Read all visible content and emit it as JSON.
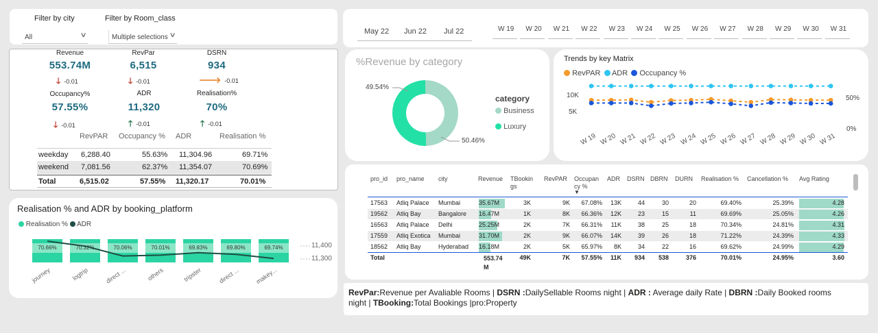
{
  "filters": {
    "city_label": "Filter by city",
    "city_value": "All",
    "room_label": "Filter by Room_class",
    "room_value": "Multiple selections"
  },
  "kpis": [
    {
      "label": "Revenue",
      "value": "553.74M",
      "delta": "-0.01",
      "trend": "down"
    },
    {
      "label": "RevPar",
      "value": "6,515",
      "delta": "-0.01",
      "trend": "down"
    },
    {
      "label": "DSRN",
      "value": "934",
      "delta": "-0.01",
      "trend": "right"
    },
    {
      "label": "Occupancy%",
      "value": "57.55%",
      "delta": "-0.01",
      "trend": "down"
    },
    {
      "label": "ADR",
      "value": "11,320",
      "delta": "-0.01",
      "trend": "up"
    },
    {
      "label": "Realisation%",
      "value": "70%",
      "delta": "-0.01",
      "trend": "up"
    }
  ],
  "day_table": {
    "headers": [
      "RevPAR",
      "Occupancy %",
      "ADR",
      "Realisation %"
    ],
    "rows": [
      {
        "name": "weekday",
        "revpar": "6,288.40",
        "occ": "55.63%",
        "adr": "11,304.96",
        "real": "69.71%"
      },
      {
        "name": "weekend",
        "revpar": "7,081.56",
        "occ": "62.37%",
        "adr": "11,354.07",
        "real": "70.69%"
      }
    ],
    "total": {
      "name": "Total",
      "revpar": "6,515.02",
      "occ": "57.55%",
      "adr": "11,320.17",
      "real": "70.01%"
    }
  },
  "platform_chart": {
    "title": "Realisation % and ADR by booking_platform",
    "legend": [
      "Realisation %",
      "ADR"
    ],
    "y_ticks": [
      "11,400",
      "11,300"
    ]
  },
  "dates": {
    "months": [
      "May 22",
      "Jun 22",
      "Jul 22"
    ],
    "weeks": [
      "W 19",
      "W 20",
      "W 21",
      "W 22",
      "W 23",
      "W 24",
      "W 25",
      "W 26",
      "W 27",
      "W 28",
      "W 29",
      "W 30",
      "W 31"
    ]
  },
  "donut": {
    "title": "%Revenue by category",
    "legend_title": "category",
    "labels": [
      "Business",
      "Luxury"
    ],
    "pct_labels": [
      "49.54%",
      "50.46%"
    ]
  },
  "trends": {
    "title": "Trends by key Matrix",
    "legend": [
      "RevPAR",
      "ADR",
      "Occupancy %"
    ],
    "y_left": [
      "10K",
      "5K"
    ],
    "y_right": [
      "50%",
      "0%"
    ]
  },
  "property_table": {
    "headers": [
      "pro_id",
      "pro_name",
      "city",
      "Revenue",
      "TBookin gs",
      "RevPAR",
      "Occupan cy %",
      "ADR",
      "DSRN",
      "DBRN",
      "DURN",
      "Realisation %",
      "Cancellation %",
      "Avg Rating"
    ],
    "rows": [
      [
        "17563",
        "Atliq Palace",
        "Mumbai",
        "35.67M",
        "3K",
        "9K",
        "67.08%",
        "13K",
        "44",
        "30",
        "20",
        "69.40%",
        "25.39%",
        "4.28"
      ],
      [
        "19562",
        "Atliq Bay",
        "Bangalore",
        "16.47M",
        "1K",
        "8K",
        "66.36%",
        "12K",
        "23",
        "15",
        "11",
        "69.69%",
        "25.05%",
        "4.26"
      ],
      [
        "16563",
        "Atliq Palace",
        "Delhi",
        "25.25M",
        "2K",
        "7K",
        "66.31%",
        "11K",
        "38",
        "25",
        "18",
        "70.34%",
        "24.81%",
        "4.31"
      ],
      [
        "17559",
        "Atliq Exotica",
        "Mumbai",
        "31.70M",
        "2K",
        "9K",
        "66.07%",
        "14K",
        "39",
        "26",
        "18",
        "71.22%",
        "24.39%",
        "4.33"
      ],
      [
        "18562",
        "Atliq Bay",
        "Hyderabad",
        "16.18M",
        "2K",
        "5K",
        "65.97%",
        "8K",
        "34",
        "22",
        "16",
        "69.62%",
        "24.99%",
        "4.29"
      ]
    ],
    "total": [
      "Total",
      "",
      "",
      "553.74 M",
      "49K",
      "7K",
      "57.55%",
      "11K",
      "934",
      "538",
      "376",
      "70.01%",
      "24.95%",
      "3.60"
    ]
  },
  "glossary": {
    "k1": "RevPar:",
    "v1": "Revenue per Avaliable Rooms | ",
    "k2": "DSRN :",
    "v2": "DailySellable Rooms night | ",
    "k3": "ADR :",
    "v3": " Average daily Rate | ",
    "k4": "DBRN :",
    "v4": "Daily Booked rooms night | ",
    "k5": "TBooking:",
    "v5": "Total Bookings |pro:Property"
  },
  "chart_data": [
    {
      "type": "pie",
      "title": "%Revenue by category",
      "categories": [
        "Business",
        "Luxury"
      ],
      "values": [
        49.54,
        50.46
      ],
      "colors": [
        "#a3d9c6",
        "#23e0a6"
      ]
    },
    {
      "type": "line",
      "title": "Trends by key Matrix",
      "x": [
        "W 19",
        "W 20",
        "W 21",
        "W 22",
        "W 23",
        "W 24",
        "W 25",
        "W 26",
        "W 27",
        "W 28",
        "W 29",
        "W 30",
        "W 31"
      ],
      "series": [
        {
          "name": "RevPAR",
          "axis": "left",
          "color": "#f59b2b",
          "values": [
            6500,
            6500,
            6600,
            5800,
            6400,
            6500,
            6800,
            6300,
            5800,
            6700,
            6600,
            6500,
            6500
          ]
        },
        {
          "name": "ADR",
          "axis": "left",
          "color": "#2ec5f0",
          "values": [
            11300,
            11300,
            11300,
            11300,
            11300,
            11300,
            11300,
            11300,
            11300,
            11300,
            11300,
            11300,
            11300
          ]
        },
        {
          "name": "Occupancy %",
          "axis": "right",
          "color": "#1a56db",
          "values": [
            58,
            58,
            58,
            51,
            57,
            58,
            60,
            56,
            51,
            59,
            58,
            57,
            57
          ]
        }
      ],
      "ylim_left": [
        0,
        14000
      ],
      "ylim_right": [
        0,
        100
      ]
    },
    {
      "type": "bar",
      "title": "Realisation % and ADR by booking_platform",
      "categories": [
        "journey",
        "logtrip",
        "direct ...",
        "others",
        "tripster",
        "direct ...",
        "makey..."
      ],
      "series": [
        {
          "name": "Realisation %",
          "color": "#2bd4a3",
          "values": [
            70.66,
            70.32,
            70.06,
            70.01,
            69.83,
            69.8,
            69.74
          ]
        },
        {
          "name": "ADR",
          "color": "#1f4e45",
          "values": [
            11400,
            11370,
            11310,
            11315,
            11330,
            11320,
            11295
          ]
        }
      ],
      "ylim_adr": [
        11200,
        11450
      ]
    }
  ]
}
